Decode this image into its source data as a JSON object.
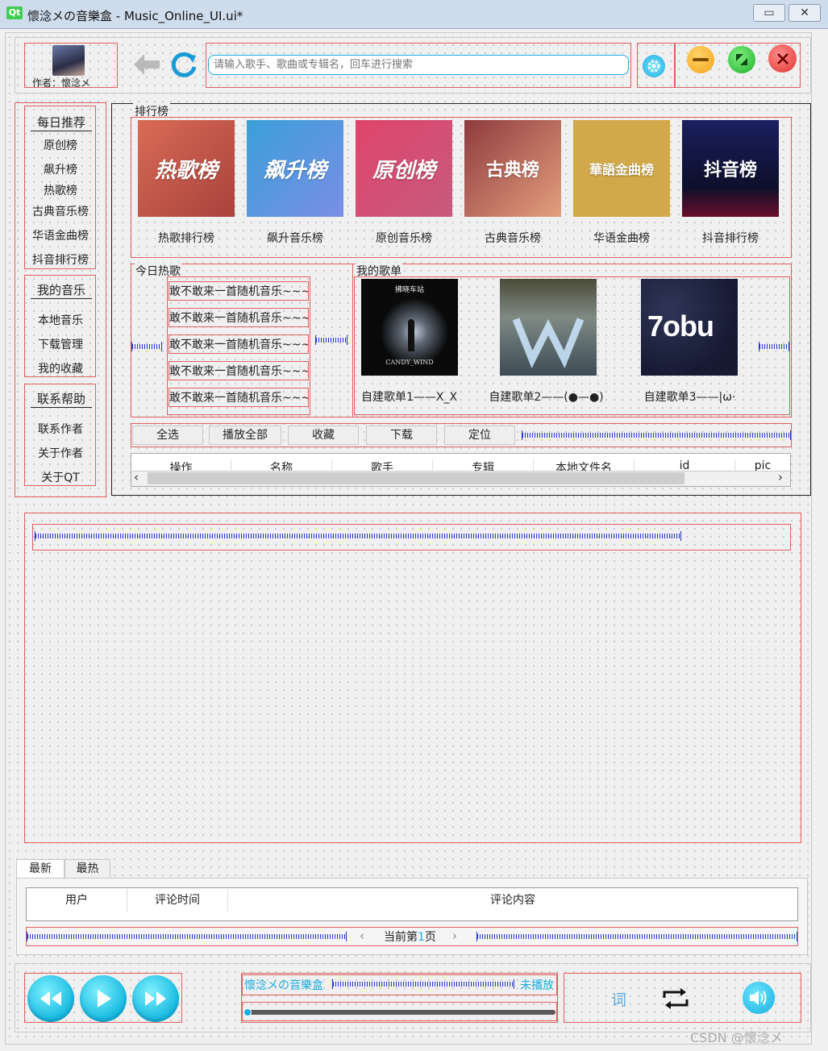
{
  "window": {
    "logo": "Qt",
    "title": "懷淰メの音樂盒 - Music_Online_UI.ui*",
    "minimize": "▭",
    "close": "✕"
  },
  "header": {
    "author_label": "作者：懷淰メ",
    "search_placeholder": "请输入歌手、歌曲或专辑名，回车进行搜索"
  },
  "sidebar": {
    "groups": [
      {
        "title": "每日推荐",
        "items": [
          "原创榜",
          "飙升榜",
          "热歌榜",
          "古典音乐榜",
          "华语金曲榜",
          "抖音排行榜"
        ]
      },
      {
        "title": "我的音乐",
        "items": [
          "本地音乐",
          "下载管理",
          "我的收藏"
        ]
      },
      {
        "title": "联系帮助",
        "items": [
          "联系作者",
          "关于作者",
          "关于QT"
        ]
      }
    ]
  },
  "ranking": {
    "title": "排行榜",
    "cards": [
      {
        "art": "热歌榜",
        "label": "热歌排行榜",
        "color": "#c0594a"
      },
      {
        "art": "飙升榜",
        "label": "飙升音乐榜",
        "color": "#4e8fdc"
      },
      {
        "art": "原创榜",
        "label": "原创音乐榜",
        "color": "#d04a6e"
      },
      {
        "art": "古典榜",
        "label": "古典音乐榜",
        "color": "#b5615a"
      },
      {
        "art": "華語金曲榜",
        "label": "华语金曲榜",
        "color": "#d1a94b"
      },
      {
        "art": "抖音榜",
        "label": "抖音排行榜",
        "color": "#1b1f5e"
      }
    ]
  },
  "today_hot": {
    "title": "今日热歌",
    "items": [
      "敢不敢来一首随机音乐~~~",
      "敢不敢来一首随机音乐~~~",
      "敢不敢来一首随机音乐~~~",
      "敢不敢来一首随机音乐~~~",
      "敢不敢来一首随机音乐~~~"
    ]
  },
  "my_playlists": {
    "title": "我的歌单",
    "items": [
      {
        "label": "自建歌单1——X_X",
        "cover_top": "拂晓车站",
        "cover_bottom": "CANDY_WIND"
      },
      {
        "label": "自建歌单2——(●—●)",
        "cover_top": "",
        "cover_bottom": ""
      },
      {
        "label": "自建歌单3——|ω·",
        "cover_top": "",
        "cover_bottom": "7obu"
      }
    ]
  },
  "toolbar": {
    "buttons": [
      "全选",
      "播放全部",
      "收藏",
      "下载",
      "定位"
    ]
  },
  "song_table": {
    "columns": [
      "操作",
      "名称",
      "歌手",
      "专辑",
      "本地文件名",
      "id",
      "pic"
    ]
  },
  "comments": {
    "tabs": [
      "最新",
      "最热"
    ],
    "columns": [
      "用户",
      "评论时间",
      "评论内容"
    ],
    "pager_prefix": "当前第",
    "pager_page": "1",
    "pager_suffix": "页",
    "prev": "‹",
    "next": "›"
  },
  "player": {
    "song_title": "懷淰メの音樂盒",
    "status": "未播放",
    "lyrics_label": "词",
    "progress": 0
  },
  "watermark": "CSDN @懷淰メ",
  "colors": {
    "accent": "#1aaee0",
    "guide": "#e06060"
  }
}
